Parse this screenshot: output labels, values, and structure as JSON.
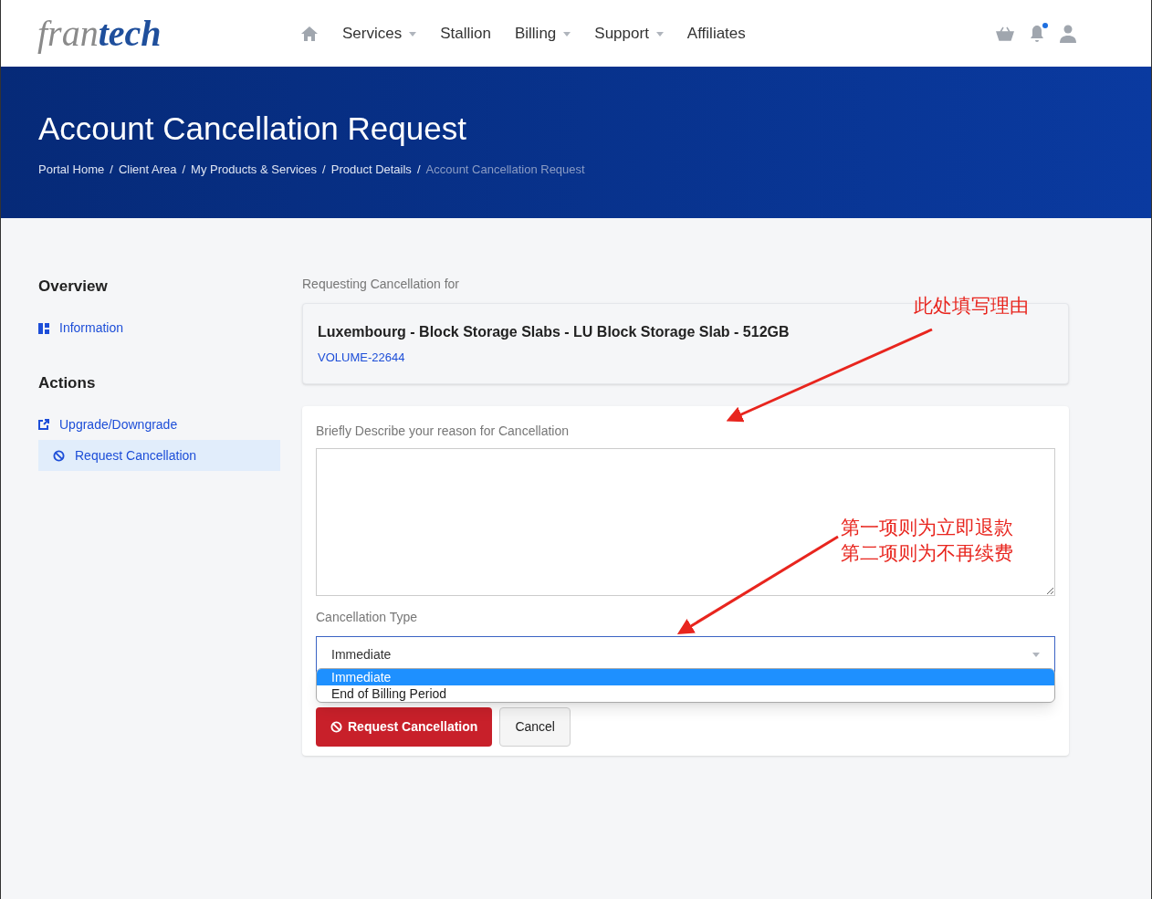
{
  "logo": {
    "part1": "fran",
    "part2": "tech"
  },
  "nav": [
    {
      "label": "Services",
      "dropdown": true
    },
    {
      "label": "Stallion",
      "dropdown": false
    },
    {
      "label": "Billing",
      "dropdown": true
    },
    {
      "label": "Support",
      "dropdown": true
    },
    {
      "label": "Affiliates",
      "dropdown": false
    }
  ],
  "notifications": {
    "unread": true
  },
  "banner": {
    "title": "Account Cancellation Request",
    "separator": "/",
    "breadcrumb": [
      {
        "label": "Portal Home",
        "current": false
      },
      {
        "label": "Client Area",
        "current": false
      },
      {
        "label": "My Products & Services",
        "current": false
      },
      {
        "label": "Product Details",
        "current": false
      },
      {
        "label": "Account Cancellation Request",
        "current": true
      }
    ]
  },
  "sidebar": {
    "sections": [
      {
        "title": "Overview",
        "items": [
          {
            "label": "Information",
            "kind": "info",
            "selected": false
          }
        ]
      },
      {
        "title": "Actions",
        "items": [
          {
            "label": "Upgrade/Downgrade",
            "kind": "upgrade",
            "selected": false
          },
          {
            "label": "Request Cancellation",
            "kind": "cancel",
            "selected": true
          }
        ]
      }
    ]
  },
  "product": {
    "caption": "Requesting Cancellation for",
    "name": "Luxembourg - Block Storage Slabs - LU Block Storage Slab - 512GB",
    "id": "VOLUME-22644"
  },
  "form": {
    "reason_label": "Briefly Describe your reason for Cancellation",
    "type_label": "Cancellation Type",
    "type_value": "Immediate",
    "options": [
      {
        "label": "Immediate",
        "selected": true
      },
      {
        "label": "End of Billing Period",
        "selected": false
      }
    ],
    "submit": "Request Cancellation",
    "cancel": "Cancel"
  },
  "annotations": [
    {
      "lines": [
        "此处填写理由"
      ]
    },
    {
      "lines": [
        "第一项则为立即退款",
        "第二项则为不再续费"
      ]
    }
  ]
}
